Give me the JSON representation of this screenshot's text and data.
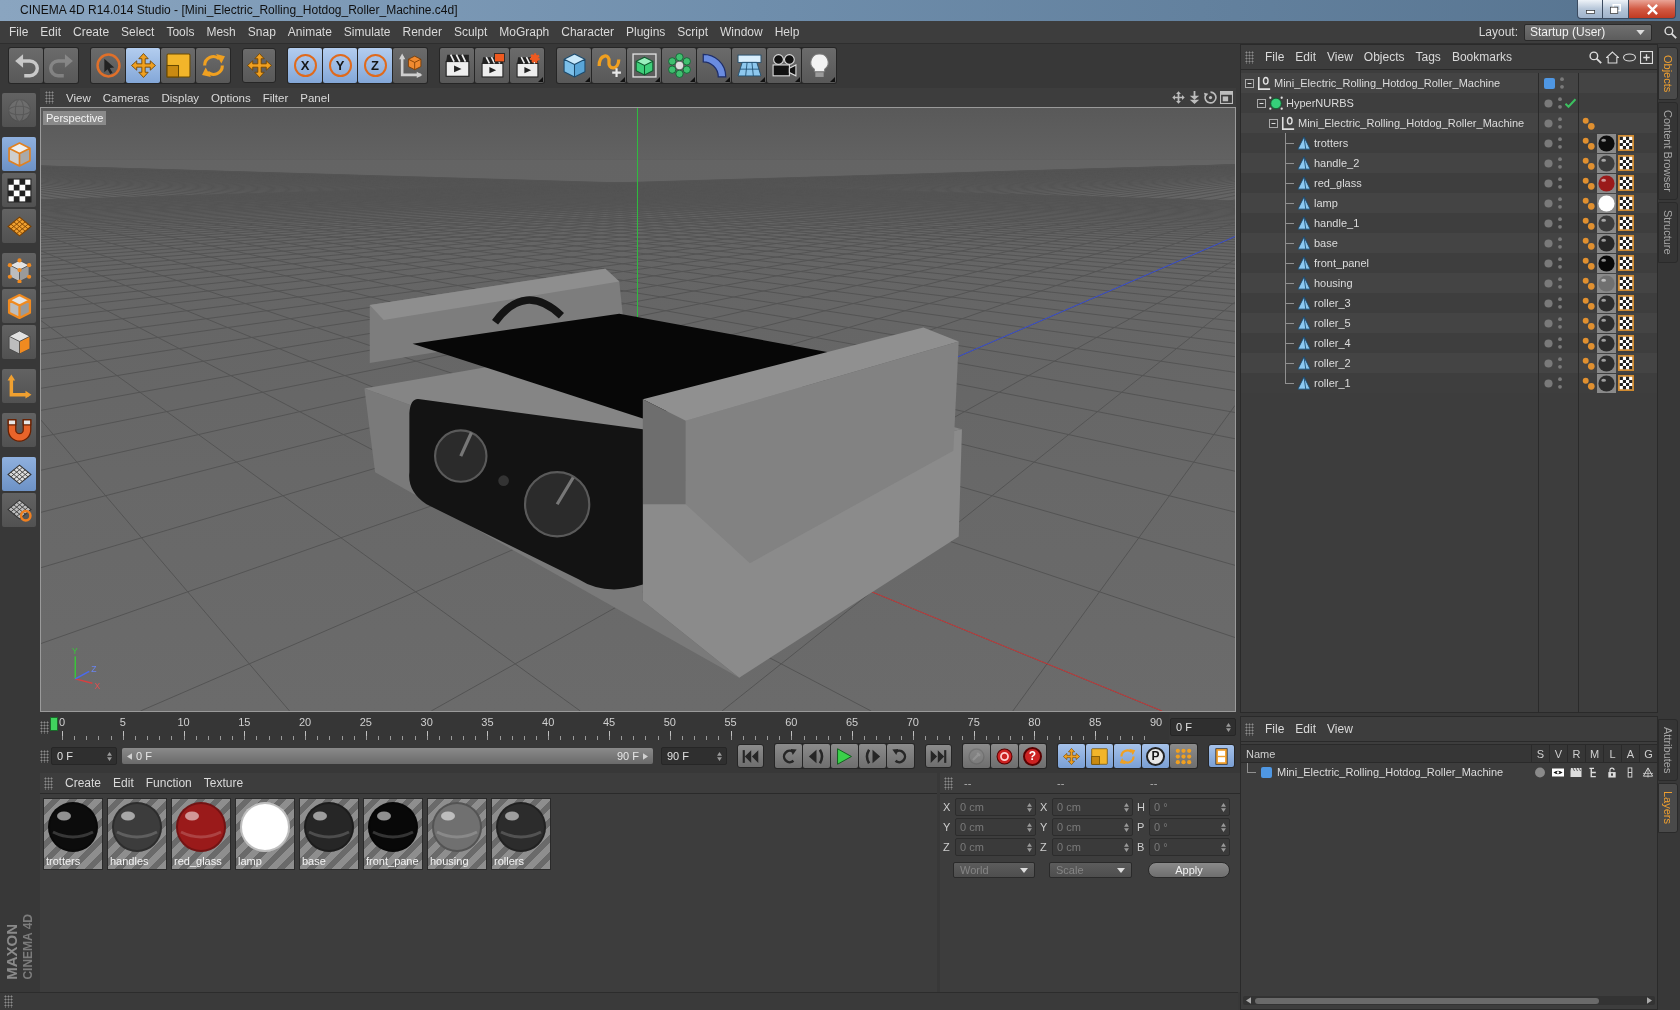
{
  "window": {
    "title": "CINEMA 4D R14.014 Studio - [Mini_Electric_Rolling_Hotdog_Roller_Machine.c4d]",
    "controls": [
      {
        "kind": "minimize"
      },
      {
        "kind": "maximize"
      },
      {
        "kind": "close"
      }
    ]
  },
  "menu_bar": [
    "File",
    "Edit",
    "Create",
    "Select",
    "Tools",
    "Mesh",
    "Snap",
    "Animate",
    "Simulate",
    "Render",
    "Sculpt",
    "MoGraph",
    "Character",
    "Plugins",
    "Script",
    "Window",
    "Help"
  ],
  "layout": {
    "label": "Layout:",
    "value": "Startup (User)"
  },
  "toolbar": [
    [
      {
        "kind": "undo",
        "disabled": false
      },
      {
        "kind": "redo",
        "disabled": true
      }
    ],
    [
      {
        "kind": "live-select",
        "selected": false
      },
      {
        "kind": "move",
        "selected": true
      },
      {
        "kind": "scale",
        "selected": false
      },
      {
        "kind": "rotate",
        "selected": false
      }
    ],
    [
      {
        "kind": "recent-tool"
      }
    ],
    [
      {
        "kind": "axis",
        "label": "X",
        "selected": true
      },
      {
        "kind": "axis",
        "label": "Y",
        "selected": true
      },
      {
        "kind": "axis",
        "label": "Z",
        "selected": true
      },
      {
        "kind": "coordinate-system",
        "selected": false
      }
    ],
    [
      {
        "kind": "render-view"
      },
      {
        "kind": "render-picture-viewer"
      },
      {
        "kind": "render-settings"
      }
    ],
    [
      {
        "kind": "cube"
      },
      {
        "kind": "spline"
      },
      {
        "kind": "nurbs"
      },
      {
        "kind": "array"
      },
      {
        "kind": "deformer"
      },
      {
        "kind": "floor"
      },
      {
        "kind": "camera"
      },
      {
        "kind": "light"
      }
    ]
  ],
  "tools": [
    [
      {
        "kind": "make-editable",
        "disabled": true
      }
    ],
    [
      {
        "kind": "model",
        "selected": true
      },
      {
        "kind": "texture",
        "selected": false
      },
      {
        "kind": "workplane",
        "selected": false
      }
    ],
    [
      {
        "kind": "points",
        "selected": false
      },
      {
        "kind": "edges",
        "selected": false
      },
      {
        "kind": "polygons",
        "selected": false
      }
    ],
    [
      {
        "kind": "axis",
        "selected": false
      }
    ],
    [
      {
        "kind": "magnet",
        "selected": false
      }
    ],
    [
      {
        "kind": "snap",
        "selected": true
      },
      {
        "kind": "locked-workplane",
        "selected": false
      }
    ]
  ],
  "logo": [
    "MAXON",
    "CINEMA 4D"
  ],
  "viewport": {
    "menu": [
      "View",
      "Cameras",
      "Display",
      "Options",
      "Filter",
      "Panel"
    ],
    "nav": [
      {
        "kind": "move"
      },
      {
        "kind": "dolly"
      },
      {
        "kind": "rotate"
      },
      {
        "kind": "maximize"
      }
    ],
    "camera": "Perspective",
    "gizmo_labels": [
      "Y",
      "Z",
      "X"
    ]
  },
  "timeline": {
    "ticks": [
      "0",
      "5",
      "10",
      "15",
      "20",
      "25",
      "30",
      "35",
      "40",
      "45",
      "50",
      "55",
      "60",
      "65",
      "70",
      "75",
      "80",
      "85",
      "90"
    ],
    "level": 0,
    "current_frame": "0 F"
  },
  "transport": {
    "start_frame": "0 F",
    "range": {
      "start": "0 F",
      "end": "90 F",
      "level": 1
    },
    "end_frame": "90 F",
    "groups": [
      [
        {
          "kind": "go-start"
        }
      ],
      [
        {
          "kind": "previous-key"
        },
        {
          "kind": "previous-frame"
        },
        {
          "kind": "play"
        },
        {
          "kind": "next-frame"
        },
        {
          "kind": "next-key"
        }
      ],
      [
        {
          "kind": "go-end"
        }
      ],
      [
        {
          "kind": "record-key",
          "disabled": true
        },
        {
          "kind": "autokey",
          "disabled": false
        },
        {
          "kind": "keyframe-selection",
          "label": "?",
          "disabled": false
        }
      ],
      [
        {
          "kind": "position",
          "selected": true
        },
        {
          "kind": "scale",
          "selected": true
        },
        {
          "kind": "rotation",
          "selected": true
        },
        {
          "kind": "parameter",
          "label": "P",
          "selected": true
        },
        {
          "kind": "point-level",
          "selected": false
        }
      ],
      [
        {
          "kind": "timeline",
          "selected": true
        }
      ]
    ]
  },
  "materials": {
    "menu": [
      "Create",
      "Edit",
      "Function",
      "Texture"
    ],
    "items": [
      {
        "name": "trotters",
        "color": "#0c0c0c"
      },
      {
        "name": "handles",
        "color": "#3c3c3c"
      },
      {
        "name": "red_glass",
        "color": "#9a1a1a"
      },
      {
        "name": "lamp",
        "color": "#ffffff"
      },
      {
        "name": "base",
        "color": "#262626"
      },
      {
        "name": "front_pane",
        "color": "#080808"
      },
      {
        "name": "housing",
        "color": "#707070"
      },
      {
        "name": "rollers",
        "color": "#2c2c2c"
      }
    ]
  },
  "coordinates": {
    "columns": [
      {
        "header": "--",
        "fields": [
          {
            "label": "X",
            "value": "0 cm"
          },
          {
            "label": "Y",
            "value": "0 cm"
          },
          {
            "label": "Z",
            "value": "0 cm"
          }
        ]
      },
      {
        "header": "--",
        "fields": [
          {
            "label": "X",
            "value": "0 cm"
          },
          {
            "label": "Y",
            "value": "0 cm"
          },
          {
            "label": "Z",
            "value": "0 cm"
          }
        ]
      },
      {
        "header": "--",
        "fields": [
          {
            "label": "H",
            "value": "0 °"
          },
          {
            "label": "P",
            "value": "0 °"
          },
          {
            "label": "B",
            "value": "0 °"
          }
        ]
      }
    ],
    "mode": "World",
    "size_mode": "Scale",
    "apply": "Apply",
    "disabled": true
  },
  "objects": {
    "menu": [
      "File",
      "Edit",
      "View",
      "Objects",
      "Tags",
      "Bookmarks"
    ],
    "tools": [
      {
        "kind": "search"
      },
      {
        "kind": "home"
      },
      {
        "kind": "view"
      },
      {
        "kind": "new-window"
      }
    ],
    "tree": [
      {
        "name": "Mini_Electric_Rolling_Hotdog_Roller_Machine",
        "kind": "null",
        "expanded": true,
        "layer": {
          "color": "#4f97e3"
        },
        "children": [
          {
            "name": "HyperNURBS",
            "kind": "nurbs",
            "expanded": true,
            "enabled": true,
            "children": [
              {
                "name": "Mini_Electric_Rolling_Hotdog_Roller_Machine",
                "kind": "null",
                "expanded": true,
                "tags": [
                  {
                    "kind": "phong"
                  }
                ],
                "children": [
                  {
                    "name": "trotters",
                    "kind": "polygon",
                    "tags": [
                      {
                        "kind": "phong"
                      },
                      {
                        "kind": "material",
                        "color": "#0c0c0c"
                      },
                      {
                        "kind": "uvw"
                      }
                    ]
                  },
                  {
                    "name": "handle_2",
                    "kind": "polygon",
                    "tags": [
                      {
                        "kind": "phong"
                      },
                      {
                        "kind": "material",
                        "color": "#3c3c3c"
                      },
                      {
                        "kind": "uvw"
                      }
                    ]
                  },
                  {
                    "name": "red_glass",
                    "kind": "polygon",
                    "tags": [
                      {
                        "kind": "phong"
                      },
                      {
                        "kind": "material",
                        "color": "#9a1a1a"
                      },
                      {
                        "kind": "uvw"
                      }
                    ]
                  },
                  {
                    "name": "lamp",
                    "kind": "polygon",
                    "tags": [
                      {
                        "kind": "phong"
                      },
                      {
                        "kind": "material",
                        "color": "#ffffff"
                      },
                      {
                        "kind": "uvw"
                      }
                    ]
                  },
                  {
                    "name": "handle_1",
                    "kind": "polygon",
                    "tags": [
                      {
                        "kind": "phong"
                      },
                      {
                        "kind": "material",
                        "color": "#3c3c3c"
                      },
                      {
                        "kind": "uvw"
                      }
                    ]
                  },
                  {
                    "name": "base",
                    "kind": "polygon",
                    "tags": [
                      {
                        "kind": "phong"
                      },
                      {
                        "kind": "material",
                        "color": "#262626"
                      },
                      {
                        "kind": "uvw"
                      }
                    ]
                  },
                  {
                    "name": "front_panel",
                    "kind": "polygon",
                    "tags": [
                      {
                        "kind": "phong"
                      },
                      {
                        "kind": "material",
                        "color": "#080808"
                      },
                      {
                        "kind": "uvw"
                      }
                    ]
                  },
                  {
                    "name": "housing",
                    "kind": "polygon",
                    "tags": [
                      {
                        "kind": "phong"
                      },
                      {
                        "kind": "material",
                        "color": "#707070"
                      },
                      {
                        "kind": "uvw"
                      }
                    ]
                  },
                  {
                    "name": "roller_3",
                    "kind": "polygon",
                    "tags": [
                      {
                        "kind": "phong"
                      },
                      {
                        "kind": "material",
                        "color": "#2c2c2c"
                      },
                      {
                        "kind": "uvw"
                      }
                    ]
                  },
                  {
                    "name": "roller_5",
                    "kind": "polygon",
                    "tags": [
                      {
                        "kind": "phong"
                      },
                      {
                        "kind": "material",
                        "color": "#2c2c2c"
                      },
                      {
                        "kind": "uvw"
                      }
                    ]
                  },
                  {
                    "name": "roller_4",
                    "kind": "polygon",
                    "tags": [
                      {
                        "kind": "phong"
                      },
                      {
                        "kind": "material",
                        "color": "#2c2c2c"
                      },
                      {
                        "kind": "uvw"
                      }
                    ]
                  },
                  {
                    "name": "roller_2",
                    "kind": "polygon",
                    "tags": [
                      {
                        "kind": "phong"
                      },
                      {
                        "kind": "material",
                        "color": "#2c2c2c"
                      },
                      {
                        "kind": "uvw"
                      }
                    ]
                  },
                  {
                    "name": "roller_1",
                    "kind": "polygon",
                    "tags": [
                      {
                        "kind": "phong"
                      },
                      {
                        "kind": "material",
                        "color": "#2c2c2c"
                      },
                      {
                        "kind": "uvw"
                      }
                    ]
                  }
                ]
              }
            ]
          }
        ]
      }
    ]
  },
  "side_tabs_top": [
    {
      "label": "Objects",
      "selected": true
    },
    {
      "label": "Content Browser",
      "selected": false
    },
    {
      "label": "Structure",
      "selected": false
    }
  ],
  "layers": {
    "menu": [
      "File",
      "Edit",
      "View"
    ],
    "columns": [
      "Name",
      "S",
      "V",
      "R",
      "M",
      "L",
      "A",
      "G"
    ],
    "rows": [
      {
        "name": "Mini_Electric_Rolling_Hotdog_Roller_Machine",
        "color": "#4f97e3",
        "toggles": [
          {
            "kind": "solo",
            "on": false
          },
          {
            "kind": "visible",
            "on": true
          },
          {
            "kind": "render",
            "on": true
          },
          {
            "kind": "manager",
            "on": true
          },
          {
            "kind": "locked",
            "on": false
          },
          {
            "kind": "animation",
            "on": true
          },
          {
            "kind": "generators",
            "on": true
          }
        ]
      }
    ]
  },
  "side_tabs_bottom": [
    {
      "label": "Attributes",
      "selected": false
    },
    {
      "label": "Layers",
      "selected": true
    }
  ]
}
